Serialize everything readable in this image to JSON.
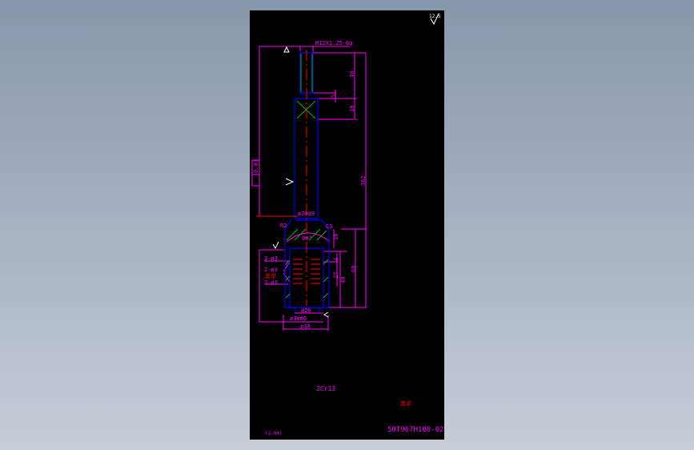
{
  "drawing": {
    "thread_spec": "M12X1.25-6g",
    "dims": {
      "d40": "40",
      "d5": "5",
      "d18": "18",
      "d362": "362",
      "d16": "16",
      "d4": "4",
      "d27": "27",
      "d49": "49",
      "d68": "68"
    },
    "tolerance_frame": "0.03",
    "shaft_dia": "ø20d9",
    "radius": "R2",
    "chamfer": "C3",
    "angle": "90°",
    "holes": [
      "3-ø3",
      "2-ø3",
      "3-ø3"
    ],
    "bore_dia": "ø20",
    "outer_dia": "ø30m6",
    "flange_dia": "ø39",
    "material": "2Cr13",
    "part_number": "50T967H100-02",
    "scale": "(2:04)",
    "surface_roughness": "12.5",
    "note": "其余"
  },
  "colors": {
    "sheet": "#000000",
    "dimension": "#ff00ff",
    "outline": "#0000ff",
    "centerline": "#ff0000",
    "hatch": "#00c000"
  }
}
